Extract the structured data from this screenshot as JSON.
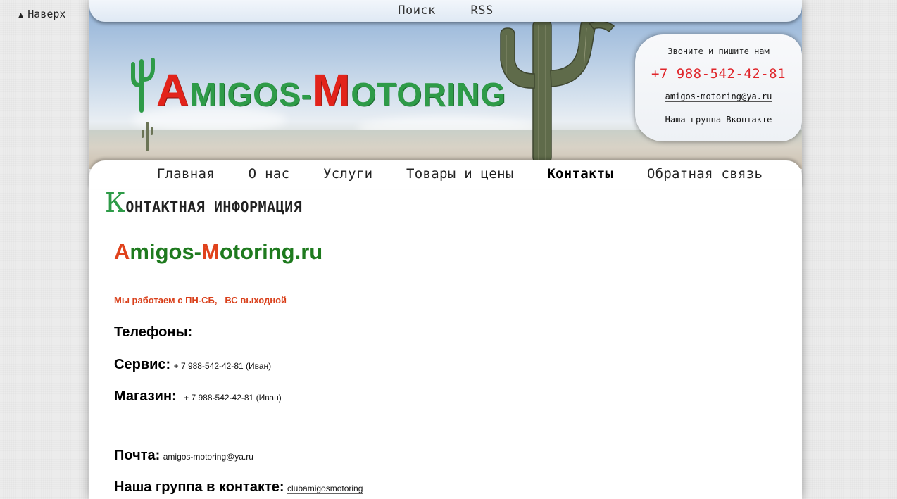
{
  "back_to_top": {
    "arrow": "▲",
    "label": "Наверх"
  },
  "topbar": {
    "search": "Поиск",
    "rss": "RSS"
  },
  "logo": {
    "A": "A",
    "migos": "MIGOS-",
    "M": "M",
    "otoring": "OTORING"
  },
  "contact_box": {
    "call_text": "Звоните и пишите нам",
    "phone": "+7 988-542-42-81",
    "email": "amigos-motoring@ya.ru",
    "vk": "Наша группа Вконтакте"
  },
  "nav": {
    "items": [
      "Главная",
      "О нас",
      "Услуги",
      "Товары и цены",
      "Контакты",
      "Обратная связь"
    ],
    "active": "Контакты"
  },
  "page_title": {
    "cap": "К",
    "rest": "онтактная информация"
  },
  "content": {
    "site_name_a": "A",
    "site_name_mid": "migos-",
    "site_name_m": "M",
    "site_name_end": "otoring.ru",
    "hours": "Мы работаем с ПН-СБ,   ВС выходной",
    "phones_label": "Телефоны:",
    "service_label": "Сервис:",
    "service_value": "+ 7 988-542-42-81 (Иван)",
    "shop_label": "Магазин:",
    "shop_value": "+ 7 988-542-42-81 (Иван)",
    "mail_label": "Почта:",
    "mail_value": "amigos-motoring@ya.ru",
    "group_label": "Наша группа в контакте:",
    "group_value": "clubamigosmotoring"
  },
  "colors": {
    "accent_red": "#e0262b",
    "logo_green": "#2e9b48",
    "site_green": "#1e7a1e",
    "hours_orange": "#d9401b"
  }
}
